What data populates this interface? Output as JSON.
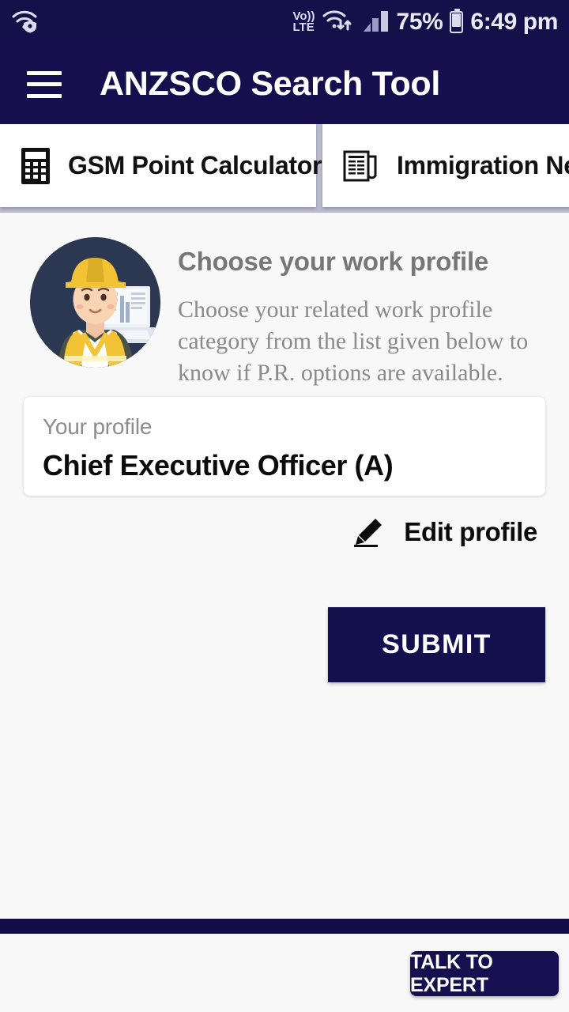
{
  "status_bar": {
    "wifi_secure_icon": "wifi-shield-icon",
    "volte_top": "Vo))",
    "volte_bottom": "LTE",
    "wifi_transfer_icon": "wifi-transfer-icon",
    "signal_icon": "signal-bars-icon",
    "battery_percent": "75%",
    "battery_icon": "battery-icon",
    "time": "6:49 pm"
  },
  "app_bar": {
    "menu_icon": "hamburger-menu-icon",
    "title": "ANZSCO Search Tool"
  },
  "tabs": [
    {
      "label": "GSM Point Calculator",
      "icon": "calculator-icon"
    },
    {
      "label": "Immigration News",
      "icon": "newspaper-icon"
    }
  ],
  "hero": {
    "illustration": "worker-with-laptop-avatar",
    "title": "Choose your work profile",
    "description": "Choose your related work profile category from the list given below to know if P.R. options are available."
  },
  "profile": {
    "label": "Your profile",
    "value": "Chief Executive Officer (A)"
  },
  "edit": {
    "icon": "pencil-icon",
    "label": "Edit profile"
  },
  "submit": {
    "label": "SUBMIT"
  },
  "bottom": {
    "talk_label": "TALK TO EXPERT"
  },
  "colors": {
    "app_bar": "#160f4d",
    "status_bar": "#14114a",
    "background": "#f8f8f9",
    "submit": "#140f4d",
    "accent_navy": "#161050",
    "avatar_bg": "#2c3852",
    "helmet_yellow": "#f2c335"
  }
}
